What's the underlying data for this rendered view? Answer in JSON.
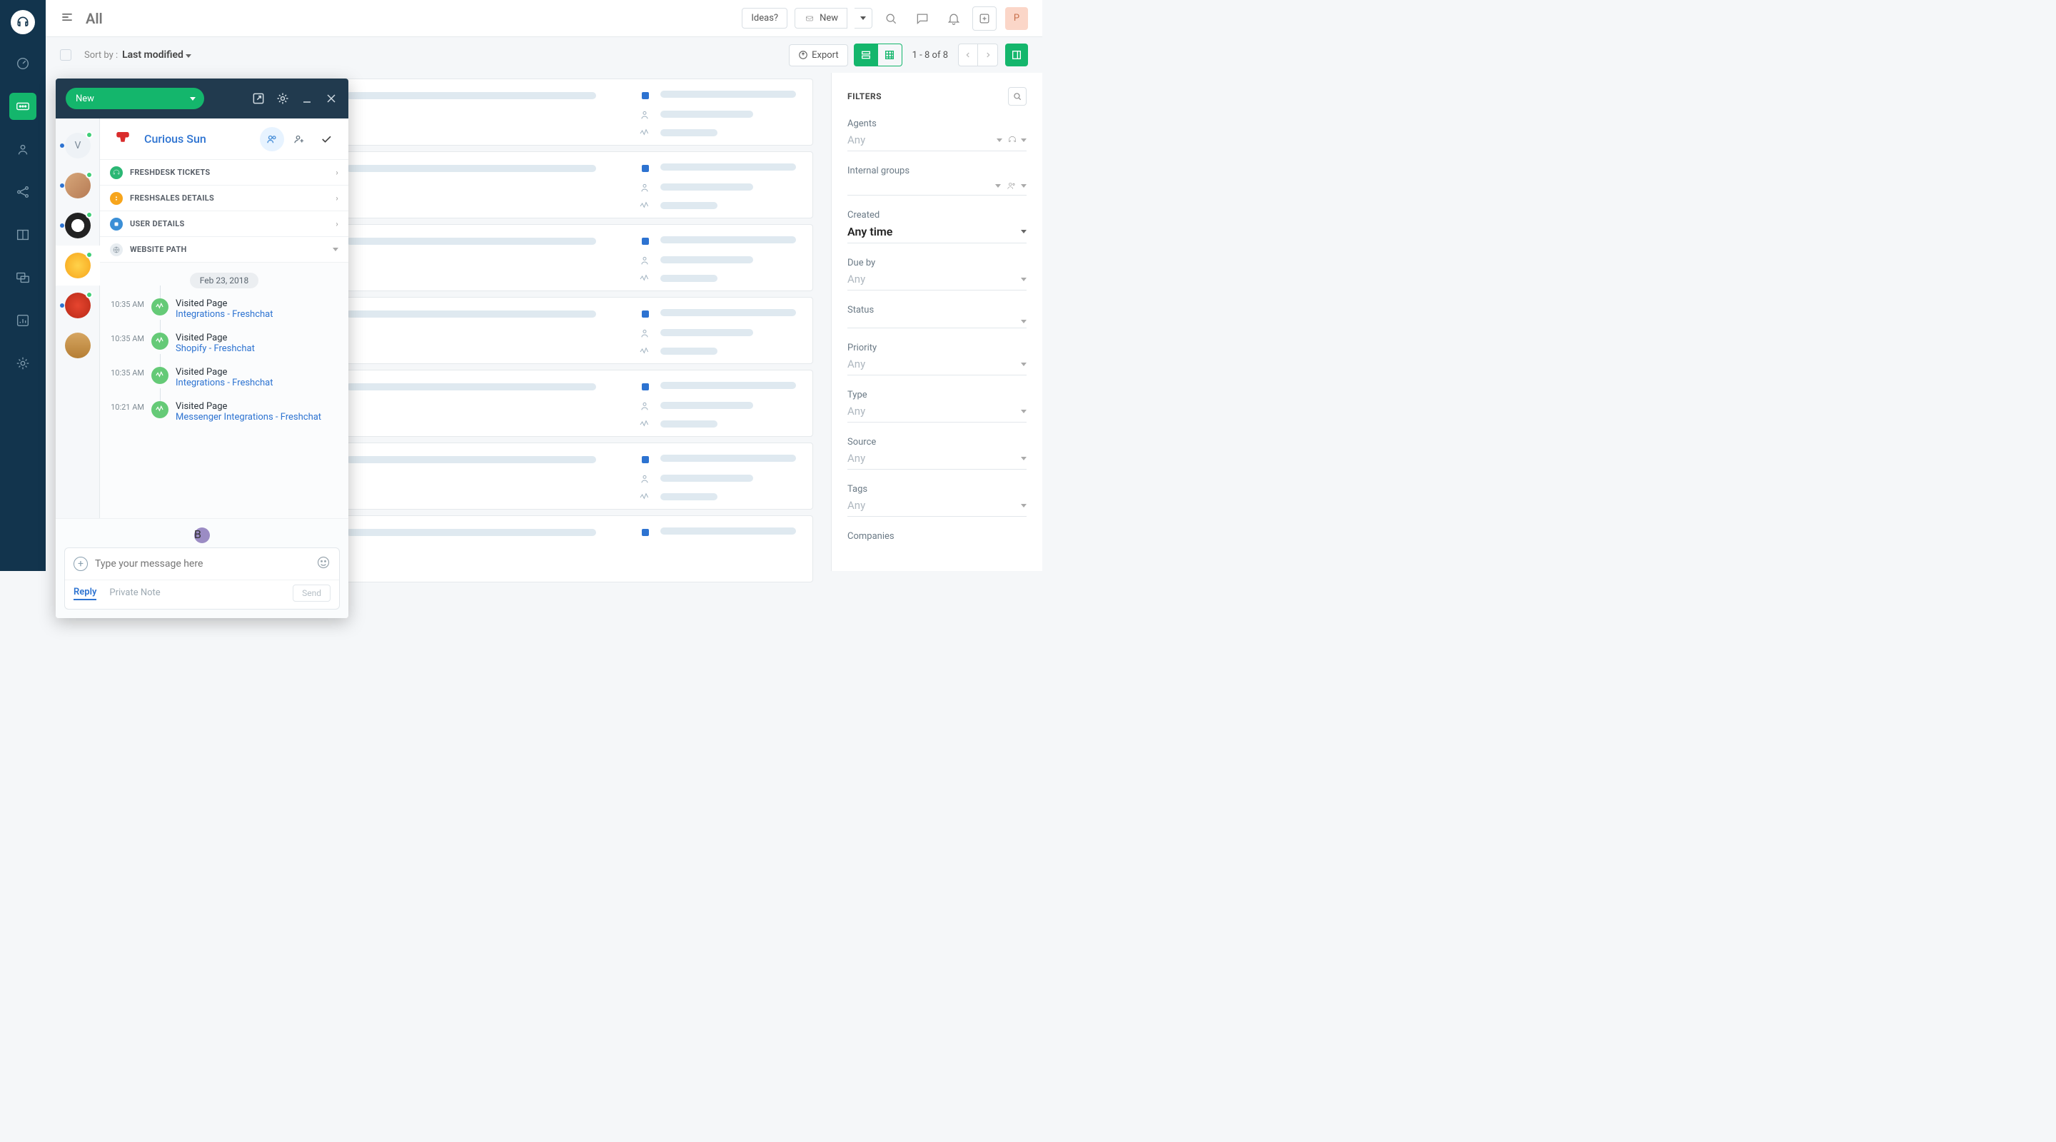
{
  "page": {
    "title": "All"
  },
  "top": {
    "ideas": "Ideas?",
    "new": "New",
    "avatar_initial": "P"
  },
  "toolbar": {
    "sort_label": "Sort by :",
    "sort_value": "Last modified",
    "export": "Export",
    "pager": "1 - 8 of 8"
  },
  "filters": {
    "title": "FILTERS",
    "agents": {
      "label": "Agents",
      "value": "Any"
    },
    "internal_groups": {
      "label": "Internal groups",
      "value": ""
    },
    "created": {
      "label": "Created",
      "value": "Any time"
    },
    "due_by": {
      "label": "Due by",
      "value": "Any"
    },
    "status": {
      "label": "Status",
      "value": ""
    },
    "priority": {
      "label": "Priority",
      "value": "Any"
    },
    "type": {
      "label": "Type",
      "value": "Any"
    },
    "source": {
      "label": "Source",
      "value": "Any"
    },
    "tags": {
      "label": "Tags",
      "value": "Any"
    },
    "companies": {
      "label": "Companies"
    }
  },
  "chat": {
    "status": "New",
    "contact_name": "Curious Sun",
    "accordion": {
      "freshdesk": "FRESHDESK TICKETS",
      "freshsales": "FRESHSALES DETAILS",
      "user": "USER DETAILS",
      "website": "WEBSITE PATH"
    },
    "timeline_date": "Feb 23, 2018",
    "events": [
      {
        "time": "10:35 AM",
        "label": "Visited Page",
        "link": "Integrations - Freshchat"
      },
      {
        "time": "10:35 AM",
        "label": "Visited Page",
        "link": "Shopify - Freshchat"
      },
      {
        "time": "10:35 AM",
        "label": "Visited Page",
        "link": "Integrations - Freshchat"
      },
      {
        "time": "10:21 AM",
        "label": "Visited Page",
        "link": "Messenger Integrations - Freshchat"
      }
    ],
    "conv_avatars": [
      "V",
      "",
      "",
      "",
      "",
      ""
    ],
    "composer": {
      "placeholder": "Type your message here",
      "reply": "Reply",
      "private": "Private Note",
      "send": "Send"
    }
  }
}
